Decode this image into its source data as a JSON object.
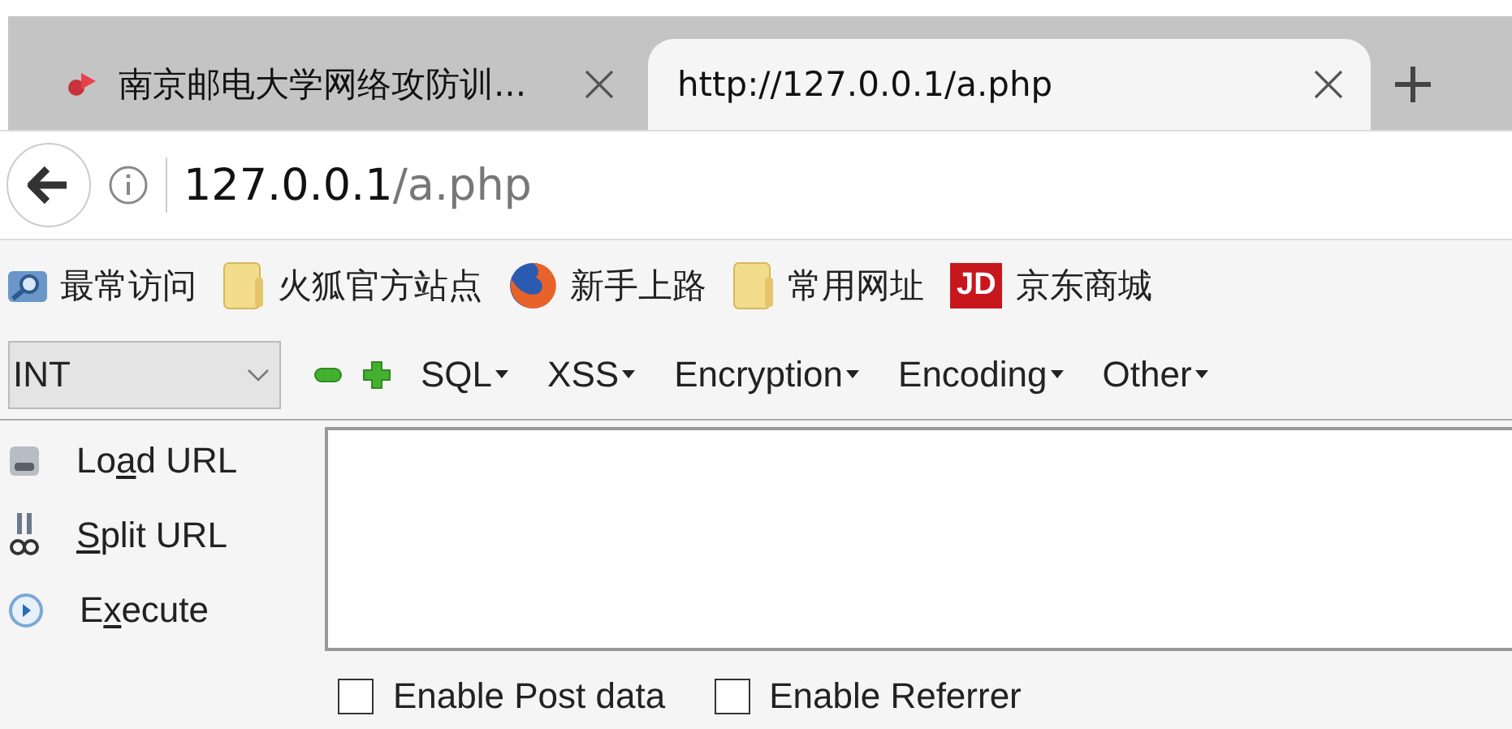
{
  "tabs": [
    {
      "title": "南京邮电大学网络攻防训...",
      "selected": false,
      "kind": "site"
    },
    {
      "title": "http://127.0.0.1/a.php",
      "selected": true,
      "kind": "blank"
    }
  ],
  "address_bar": {
    "host": "127.0.0.1",
    "path": "/a.php"
  },
  "bookmarks": [
    {
      "label": "最常访问",
      "kind": "smart"
    },
    {
      "label": "火狐官方站点",
      "kind": "folder"
    },
    {
      "label": "新手上路",
      "kind": "firefox"
    },
    {
      "label": "常用网址",
      "kind": "folder"
    },
    {
      "label": "京东商城",
      "kind": "logo",
      "badge": "JD"
    }
  ],
  "hackbar": {
    "type_select": "INT",
    "menus": [
      "SQL",
      "XSS",
      "Encryption",
      "Encoding",
      "Other"
    ],
    "actions": [
      {
        "kind": "load",
        "before": "Lo",
        "key": "a",
        "after": "d URL"
      },
      {
        "kind": "split",
        "key": "S",
        "after": "plit URL"
      },
      {
        "kind": "execute",
        "before": "E",
        "key": "x",
        "after": "ecute"
      }
    ],
    "options": [
      {
        "label": "Enable Post data",
        "checked": false
      },
      {
        "label": "Enable Referrer",
        "checked": false
      }
    ]
  }
}
